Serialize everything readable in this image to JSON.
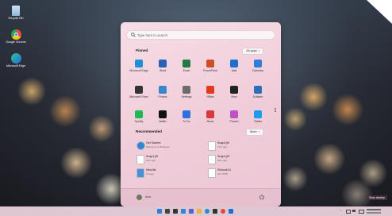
{
  "desktop_icons": [
    {
      "label": "Recycle Bin",
      "icon": "recycle-bin-icon",
      "color": "#9fc4e4"
    },
    {
      "label": "Google Chrome",
      "icon": "chrome-icon",
      "color": "#e24b3c"
    },
    {
      "label": "Microsoft Edge",
      "icon": "edge-icon",
      "color": "#2a8fd8"
    }
  ],
  "start_menu": {
    "search_placeholder": "Type here to search",
    "pinned_title": "Pinned",
    "all_apps_label": "All apps",
    "pinned": [
      {
        "label": "Microsoft Edge",
        "icon": "edge-icon",
        "color": "#1f8fd6"
      },
      {
        "label": "Word",
        "icon": "word-icon",
        "color": "#2b5fb8"
      },
      {
        "label": "Excel",
        "icon": "excel-icon",
        "color": "#1f7a45"
      },
      {
        "label": "PowerPoint",
        "icon": "powerpoint-icon",
        "color": "#d04f29"
      },
      {
        "label": "Mail",
        "icon": "mail-icon",
        "color": "#1e6fd0"
      },
      {
        "label": "Calendar",
        "icon": "calendar-icon",
        "color": "#2f7fd8"
      },
      {
        "label": "Microsoft Store",
        "icon": "store-icon",
        "color": "#333333"
      },
      {
        "label": "Photos",
        "icon": "photos-icon",
        "color": "#3a86c8"
      },
      {
        "label": "Settings",
        "icon": "settings-icon",
        "color": "#6c6c6c"
      },
      {
        "label": "Office",
        "icon": "office-icon",
        "color": "#e03a1e"
      },
      {
        "label": "Xbox",
        "icon": "xbox-icon",
        "color": "#222222"
      },
      {
        "label": "Solitaire",
        "icon": "solitaire-icon",
        "color": "#2a6fb8"
      },
      {
        "label": "Spotify",
        "icon": "spotify-icon",
        "color": "#1db954"
      },
      {
        "label": "Netflix",
        "icon": "netflix-icon",
        "color": "#111111"
      },
      {
        "label": "To Do",
        "icon": "todo-icon",
        "color": "#2f6fde"
      },
      {
        "label": "News",
        "icon": "news-icon",
        "color": "#d83a3a"
      },
      {
        "label": "PicsArt",
        "icon": "picsart-icon",
        "color": "#c052c8"
      },
      {
        "label": "Twitter",
        "icon": "twitter-icon",
        "color": "#1d9bf0"
      }
    ],
    "recommended_title": "Recommended",
    "more_label": "More",
    "recommended": [
      {
        "title": "Get Started",
        "subtitle": "Welcome to Windows",
        "icon": "get-started-icon",
        "color": "#2f86d6"
      },
      {
        "title": "Snap3.jfif",
        "subtitle": "17m ago",
        "icon": "file-icon",
        "color": "#ffffff"
      },
      {
        "title": "Snap1.jfif",
        "subtitle": "21m ago",
        "icon": "file-icon",
        "color": "#ffffff"
      },
      {
        "title": "Snap2.jfif",
        "subtitle": "22m ago",
        "icon": "file-icon",
        "color": "#ffffff"
      },
      {
        "title": "New.tifs",
        "subtitle": "1h ago",
        "icon": "image-file-icon",
        "color": "#4a90d9"
      },
      {
        "title": "Retouch11",
        "subtitle": "Jun 2018",
        "icon": "file-icon",
        "color": "#ffffff"
      }
    ],
    "user_name": "Ana"
  },
  "taskbar": {
    "icons": [
      {
        "icon": "start-icon",
        "color": "#2f7fd8"
      },
      {
        "icon": "search-icon",
        "color": "#444444"
      },
      {
        "icon": "task-view-icon",
        "color": "#333333"
      },
      {
        "icon": "widgets-icon",
        "color": "#2f86d6"
      },
      {
        "icon": "teams-icon",
        "color": "#5b5fc7"
      },
      {
        "icon": "file-explorer-icon",
        "color": "#e8b43a"
      },
      {
        "icon": "edge-icon",
        "color": "#1f8fd6"
      },
      {
        "icon": "store-icon",
        "color": "#333333"
      },
      {
        "icon": "chrome-icon",
        "color": "#e24b3c"
      },
      {
        "icon": "mail-icon",
        "color": "#1e6fd0"
      }
    ],
    "show_desktop_tooltip": "Show desktop"
  }
}
